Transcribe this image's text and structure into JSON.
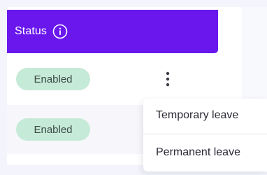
{
  "table": {
    "status_header": "Status",
    "header_color": "#6a17ee",
    "rows": [
      {
        "status": "Enabled"
      },
      {
        "status": "Enabled"
      }
    ]
  },
  "badge_color": "#c6ead8",
  "icons": {
    "header_info": "info-icon",
    "row_actions": "more-vertical-icon"
  },
  "actions_menu": {
    "items": [
      {
        "label": "Temporary leave"
      },
      {
        "label": "Permanent leave"
      }
    ]
  }
}
